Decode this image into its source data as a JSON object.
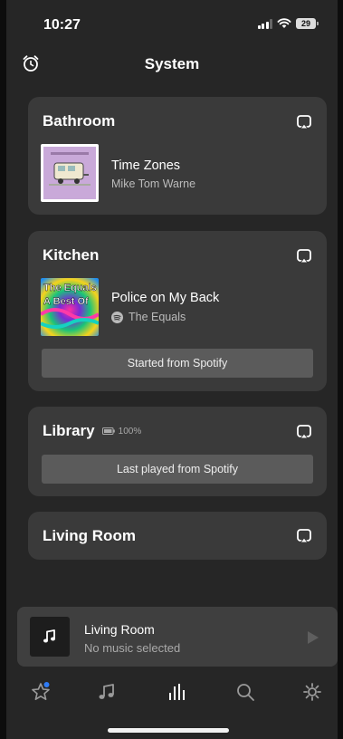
{
  "status_bar": {
    "time": "10:27",
    "battery": "29"
  },
  "header": {
    "title": "System"
  },
  "rooms": [
    {
      "name": "Bathroom",
      "track": "Time Zones",
      "artist": "Mike Tom Warne"
    },
    {
      "name": "Kitchen",
      "track": "Police on My Back",
      "artist": "The Equals",
      "album_art_text": [
        "The Equals",
        "A Best Of"
      ],
      "button": "Started from Spotify"
    },
    {
      "name": "Library",
      "battery": "100%",
      "button": "Last played from Spotify"
    },
    {
      "name": "Living Room"
    }
  ],
  "mini_player": {
    "room": "Living Room",
    "status": "No music selected"
  },
  "tabs": [
    "favorites",
    "music",
    "system",
    "search",
    "settings"
  ],
  "colors": {
    "card": "#3a3a3a",
    "accent_dot": "#2f7cf6"
  }
}
